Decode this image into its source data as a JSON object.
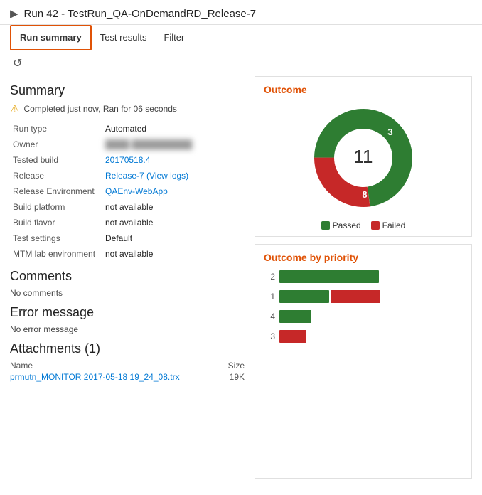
{
  "header": {
    "icon": "▶",
    "title": "Run 42 - TestRun_QA-OnDemandRD_Release-7"
  },
  "tabs": [
    {
      "id": "run-summary",
      "label": "Run summary",
      "active": true
    },
    {
      "id": "test-results",
      "label": "Test results",
      "active": false
    },
    {
      "id": "filter",
      "label": "Filter",
      "active": false
    }
  ],
  "toolbar": {
    "refresh_icon": "↺"
  },
  "summary": {
    "section_title": "Summary",
    "warning_icon": "⚠",
    "warning_text": "Completed just now, Ran for 06 seconds",
    "fields": [
      {
        "label": "Run type",
        "value": "Automated",
        "type": "text"
      },
      {
        "label": "Owner",
        "value": "████ ██████████",
        "type": "blurred"
      },
      {
        "label": "Tested build",
        "value": "20170518.4",
        "type": "link"
      },
      {
        "label": "Release",
        "value": "Release-7 (View logs)",
        "type": "link"
      },
      {
        "label": "Release Environment",
        "value": "QAEnv-WebApp",
        "type": "link"
      },
      {
        "label": "Build platform",
        "value": "not available",
        "type": "text"
      },
      {
        "label": "Build flavor",
        "value": "not available",
        "type": "text"
      },
      {
        "label": "Test settings",
        "value": "Default",
        "type": "text"
      },
      {
        "label": "MTM lab environment",
        "value": "not available",
        "type": "text"
      }
    ]
  },
  "comments": {
    "section_title": "Comments",
    "text": "No comments"
  },
  "error_message": {
    "section_title": "Error message",
    "text": "No error message"
  },
  "attachments": {
    "section_title": "Attachments (1)",
    "col_name": "Name",
    "col_size": "Size",
    "items": [
      {
        "name": "prmutn_MONITOR 2017-05-18 19_24_08.trx",
        "size": "19K"
      }
    ]
  },
  "outcome": {
    "title": "Outcome",
    "total": "11",
    "passed": 8,
    "failed": 3,
    "legend_passed": "Passed",
    "legend_failed": "Failed",
    "color_passed": "#2e7d32",
    "color_failed": "#c62828"
  },
  "outcome_by_priority": {
    "title": "Outcome by priority",
    "bars": [
      {
        "priority": "2",
        "passed": 8,
        "failed": 0,
        "passed_width": 140,
        "failed_width": 0
      },
      {
        "priority": "1",
        "passed": 4,
        "failed": 4,
        "passed_width": 70,
        "failed_width": 70
      },
      {
        "priority": "4",
        "passed": 2,
        "failed": 0,
        "passed_width": 45,
        "failed_width": 0
      },
      {
        "priority": "3",
        "passed": 0,
        "failed": 2,
        "passed_width": 0,
        "failed_width": 38
      }
    ]
  }
}
